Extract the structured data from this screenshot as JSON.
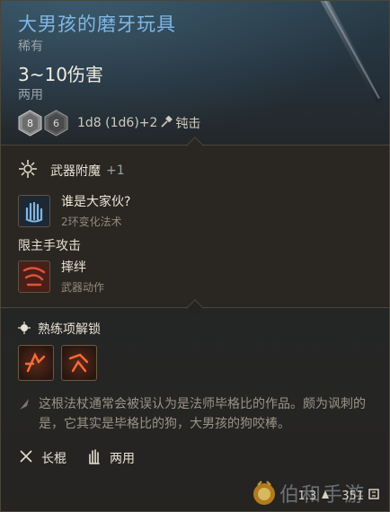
{
  "item": {
    "name": "大男孩的磨牙玩具",
    "rarity": "稀有",
    "damage": "3~10伤害",
    "handedness": "两用",
    "dice_label": "1d8 (1d6)+2",
    "damage_type": "钝击",
    "die_primary": "8",
    "die_secondary": "6"
  },
  "enchant": {
    "label": "武器附魔",
    "bonus": "+1"
  },
  "spell": {
    "title": "谁是大家伙?",
    "subtitle": "2环变化法术"
  },
  "main_hand": {
    "label": "限主手攻击",
    "action_title": "摔绊",
    "action_subtitle": "武器动作"
  },
  "proficiency": {
    "label": "熟练项解锁"
  },
  "lore": "这根法杖通常会被误认为是法师毕格比的作品。颇为讽刺的是，它其实是毕格比的狗，大男孩的狗咬棒。",
  "footer": {
    "weapon_type": "长棍",
    "grip": "两用"
  },
  "stats": {
    "weight": "1.3",
    "value": "351"
  },
  "watermark": "伯和手游",
  "colors": {
    "name": "#7fb7e6",
    "sub": "#9aa3a8",
    "panel": "#2a2722"
  }
}
